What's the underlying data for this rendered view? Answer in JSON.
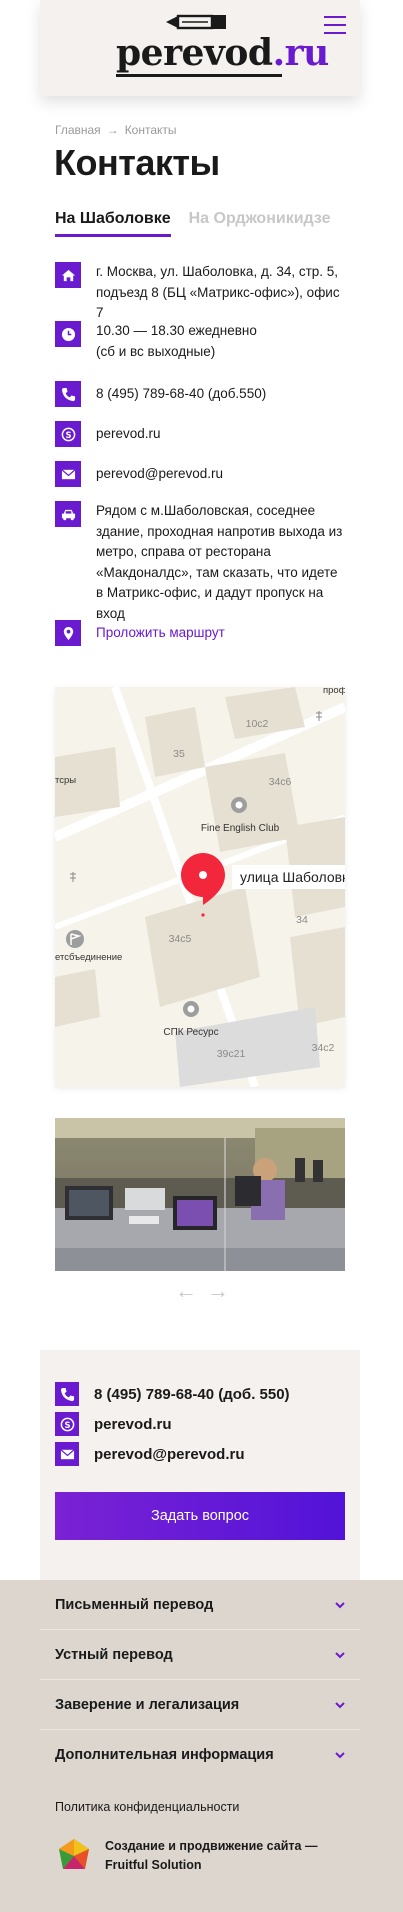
{
  "header": {
    "logo_main": "perevod",
    "logo_tld": ".ru",
    "menu_icon": "hamburger-icon",
    "accent_color": "#6a1bcf"
  },
  "breadcrumb": {
    "home": "Главная",
    "separator": "→",
    "current": "Контакты"
  },
  "page_title": "Контакты",
  "tabs": [
    {
      "label": "На Шаболовке",
      "active": true
    },
    {
      "label": "На Орджоникидзе",
      "active": false
    }
  ],
  "contacts": {
    "address": "г. Москва, ул. Шаболовка, д. 34, стр. 5, подъезд 8 (БЦ «Матрикс-офис»), офис 7",
    "hours_line1": "10.30 — 18.30 ежедневно",
    "hours_line2": "(сб и вс выходные)",
    "phone": "8 (495) 789-68-40 (доб.550)",
    "skype": "perevod.ru",
    "email": "perevod@perevod.ru",
    "directions": "Рядом с м.Шаболовская, соседнее здание, проходная напротив выхода из метро, справа от ресторана «Макдоналдс», там сказать, что идете в Матрикс-офис, и дадут пропуск на вход",
    "route_link": "Проложить маршрут"
  },
  "map": {
    "labels": {
      "b35": "35",
      "b10c2": "10с2",
      "b34c6": "34с6",
      "fine_english": "Fine English Club",
      "street": "улица Шаболовк",
      "b34": "34",
      "b34c5": "34с5",
      "spk": "СПК Ресурс",
      "b39c21": "39с21",
      "b34c2": "34с2",
      "tsry": "тсры",
      "profs": "профс",
      "tsobedinenie": "етсбъединение"
    }
  },
  "gallery": {
    "prev": "←",
    "next": "→"
  },
  "contact_box": {
    "phone": "8 (495) 789-68-40 (доб. 550)",
    "skype": "perevod.ru",
    "email": "perevod@perevod.ru",
    "ask_button": "Задать вопрос"
  },
  "footer": {
    "sections": [
      "Письменный перевод",
      "Устный перевод",
      "Заверение и легализация",
      "Дополнительная информация"
    ],
    "policy": "Политика конфиденциальности",
    "developer": "Создание и продвижение сайта — Fruitful Solution"
  }
}
